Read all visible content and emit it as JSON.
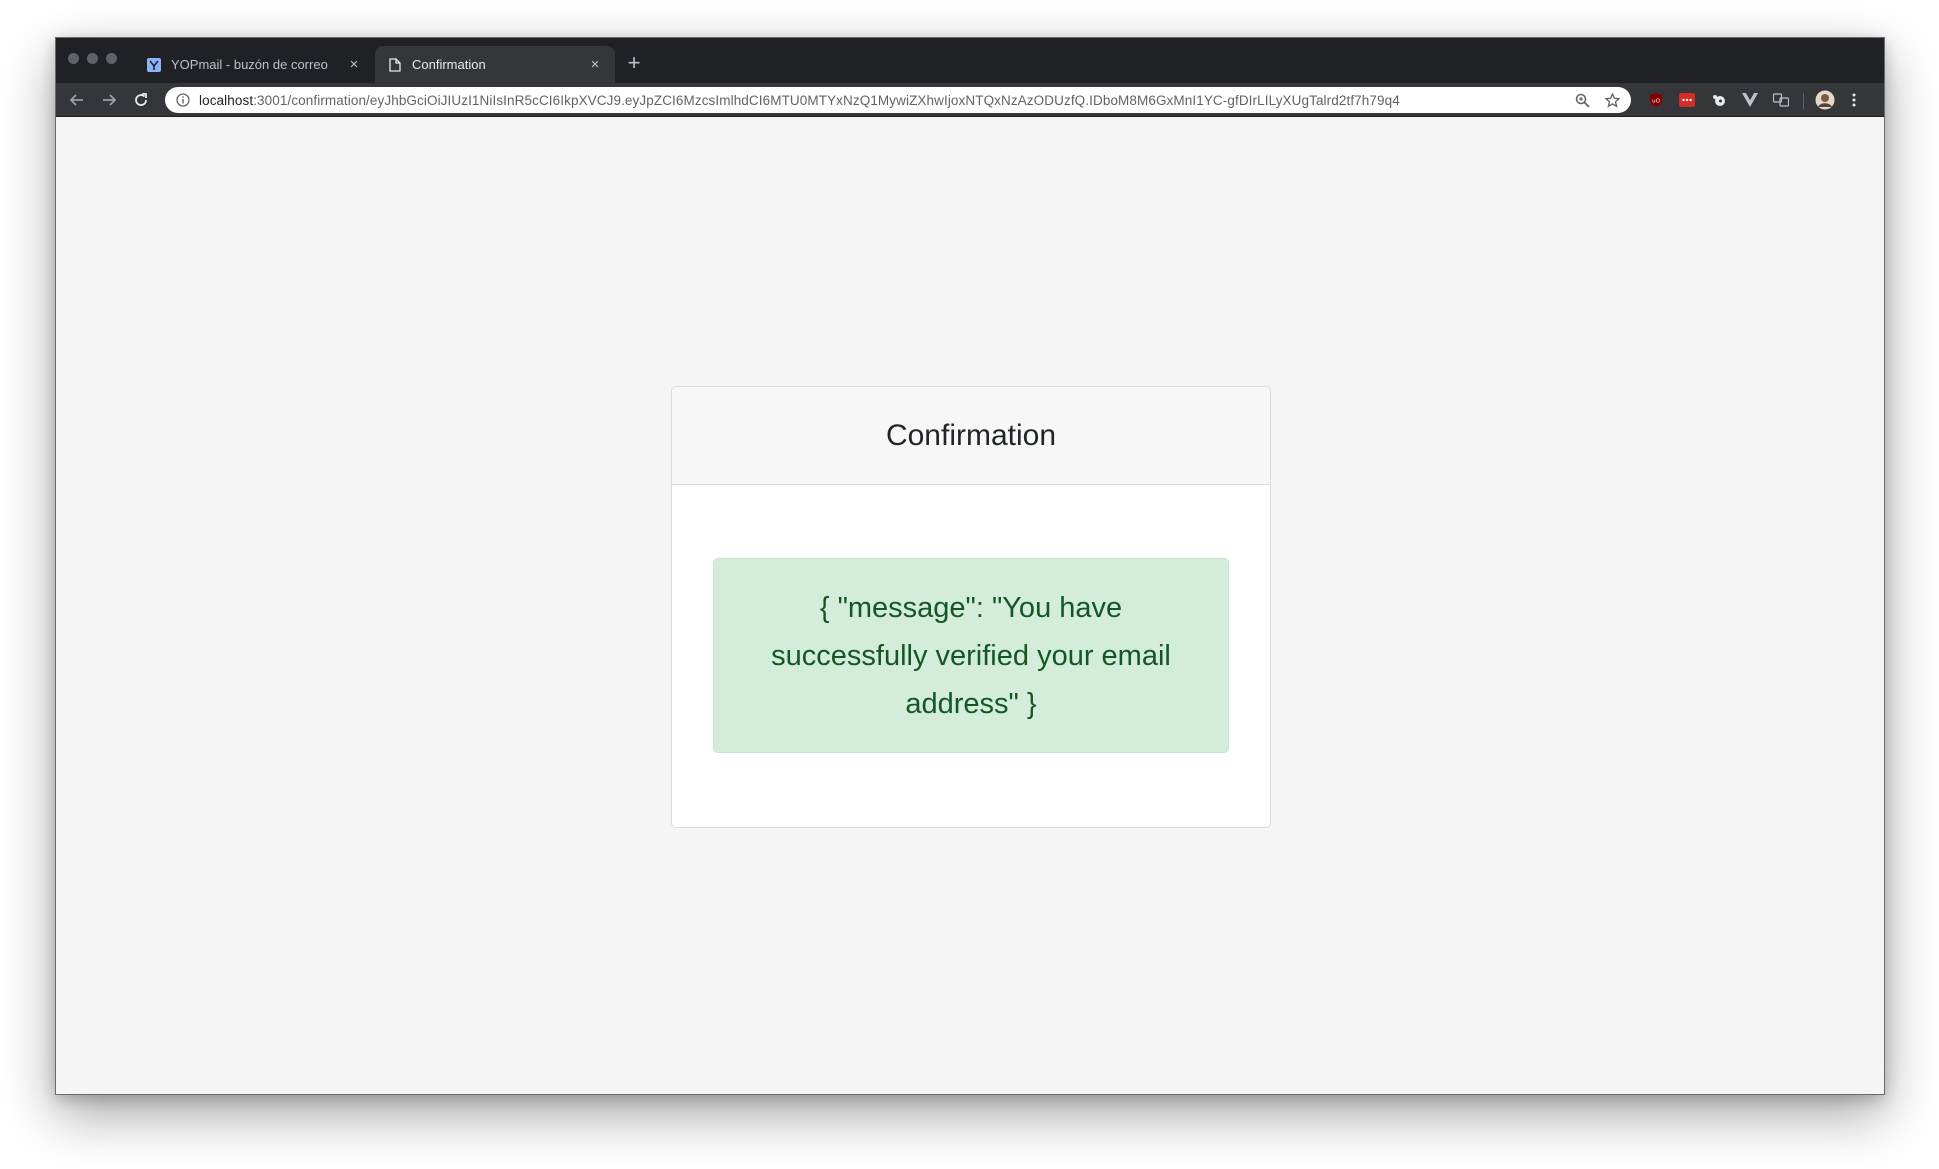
{
  "browser": {
    "tabs": [
      {
        "title": "YOPmail - buzón de correo",
        "active": false
      },
      {
        "title": "Confirmation",
        "active": true
      }
    ],
    "address": {
      "host": "localhost",
      "path": ":3001/confirmation/eyJhbGciOiJIUzI1NiIsInR5cCI6IkpXVCJ9.eyJpZCI6MzcsImlhdCI6MTU0MTYxNzQ1MywiZXhwIjoxNTQxNzAzODUzfQ.IDboM8M6GxMnI1YC-gfDIrLILyXUgTalrd2tf7h79q4"
    },
    "icons": {
      "back": "arrow-left-icon",
      "forward": "arrow-right-icon",
      "reload": "reload-icon",
      "info": "info-icon",
      "zoom": "zoom-icon",
      "bookmark": "star-icon",
      "menu": "kebab-menu-icon"
    }
  },
  "page": {
    "card_title": "Confirmation",
    "message": "{ \"message\": \"You have successfully verified your email address\" }"
  },
  "colors": {
    "alert_bg": "#d4edda",
    "alert_text": "#155724",
    "chrome_dark": "#202124"
  }
}
